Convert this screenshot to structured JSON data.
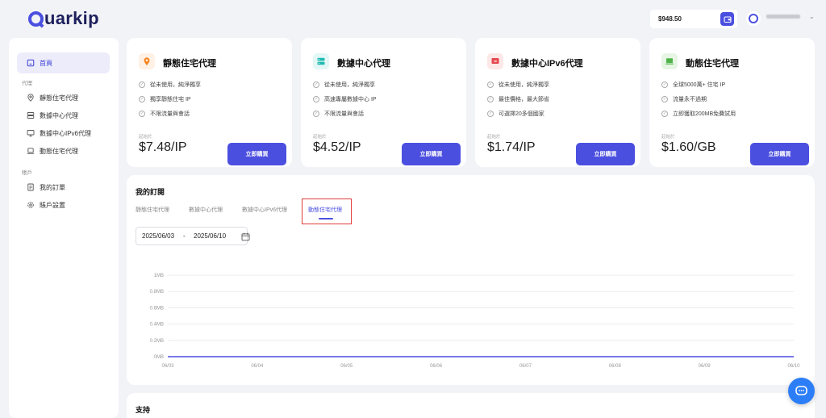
{
  "header": {
    "logo_text": "uarkip",
    "balance": "$948.50",
    "wallet_icon": "wallet-icon",
    "avatar_icon": "avatar-icon"
  },
  "sidebar": {
    "home": "首頁",
    "section_proxy": "代理",
    "items": [
      {
        "label": "靜態住宅代理",
        "icon": "location-pin-icon"
      },
      {
        "label": "數據中心代理",
        "icon": "server-icon"
      },
      {
        "label": "數據中心IPv6代理",
        "icon": "monitor-icon"
      },
      {
        "label": "動態住宅代理",
        "icon": "laptop-icon"
      }
    ],
    "section_account": "賬戶",
    "account_items": [
      {
        "label": "我的訂單",
        "icon": "document-icon"
      },
      {
        "label": "賬戶設置",
        "icon": "gear-icon"
      }
    ]
  },
  "cards": [
    {
      "title": "靜態住宅代理",
      "icon": "location-pin-icon",
      "icon_bg": "#fff1e6",
      "icon_color": "#f5841f",
      "features": [
        "從未使用，純淨獨享",
        "獨享靜態住宅 IP",
        "不限流量與會話"
      ],
      "from_label": "起始於",
      "price": "$7.48/IP",
      "buy": "立即購買"
    },
    {
      "title": "數據中心代理",
      "icon": "server-icon",
      "icon_bg": "#e3f7f6",
      "icon_color": "#1fbab0",
      "features": [
        "從未使用，純淨獨享",
        "高速專屬數據中心 IP",
        "不限流量與會話"
      ],
      "from_label": "起始於",
      "price": "$4.52/IP",
      "buy": "立即購買"
    },
    {
      "title": "數據中心IPv6代理",
      "icon": "ipv6-icon",
      "icon_bg": "#fde8e8",
      "icon_color": "#e5484d",
      "features": [
        "從未使用，純淨獨享",
        "最佳價格，最大節省",
        "可選擇20多個國家"
      ],
      "from_label": "起始於",
      "price": "$1.74/IP",
      "buy": "立即購買"
    },
    {
      "title": "動態住宅代理",
      "icon": "laptop-icon",
      "icon_bg": "#e7f5e4",
      "icon_color": "#4fb34a",
      "features": [
        "全球5000萬+ 住宅 IP",
        "流量永不過期",
        "立即獲取200MB免費試用"
      ],
      "from_label": "起始於",
      "price": "$1.60/GB",
      "buy": "立即購買"
    }
  ],
  "orders": {
    "title": "我的訂閱",
    "tabs": [
      "靜態住宅代理",
      "數據中心代理",
      "數據中心IPv6代理",
      "動態住宅代理"
    ],
    "active_tab": 3,
    "date_start": "2025/06/03",
    "date_sep": "-",
    "date_end": "2025/06/10",
    "calendar_icon": "calendar-icon"
  },
  "chart_data": {
    "type": "line",
    "x": [
      "06/03",
      "06/04",
      "06/05",
      "06/06",
      "06/07",
      "06/08",
      "06/09",
      "06/10"
    ],
    "series": [
      {
        "values": [
          0,
          0,
          0,
          0,
          0,
          0,
          0,
          0
        ]
      }
    ],
    "y_ticks": [
      "0MB",
      "0.2MB",
      "0.4MB",
      "0.6MB",
      "0.8MB",
      "1MB"
    ],
    "ylim": [
      0,
      1
    ],
    "grid": true,
    "line_color": "#4b4fe0"
  },
  "support": {
    "title": "支持"
  },
  "chat_icon": "chat-icon"
}
